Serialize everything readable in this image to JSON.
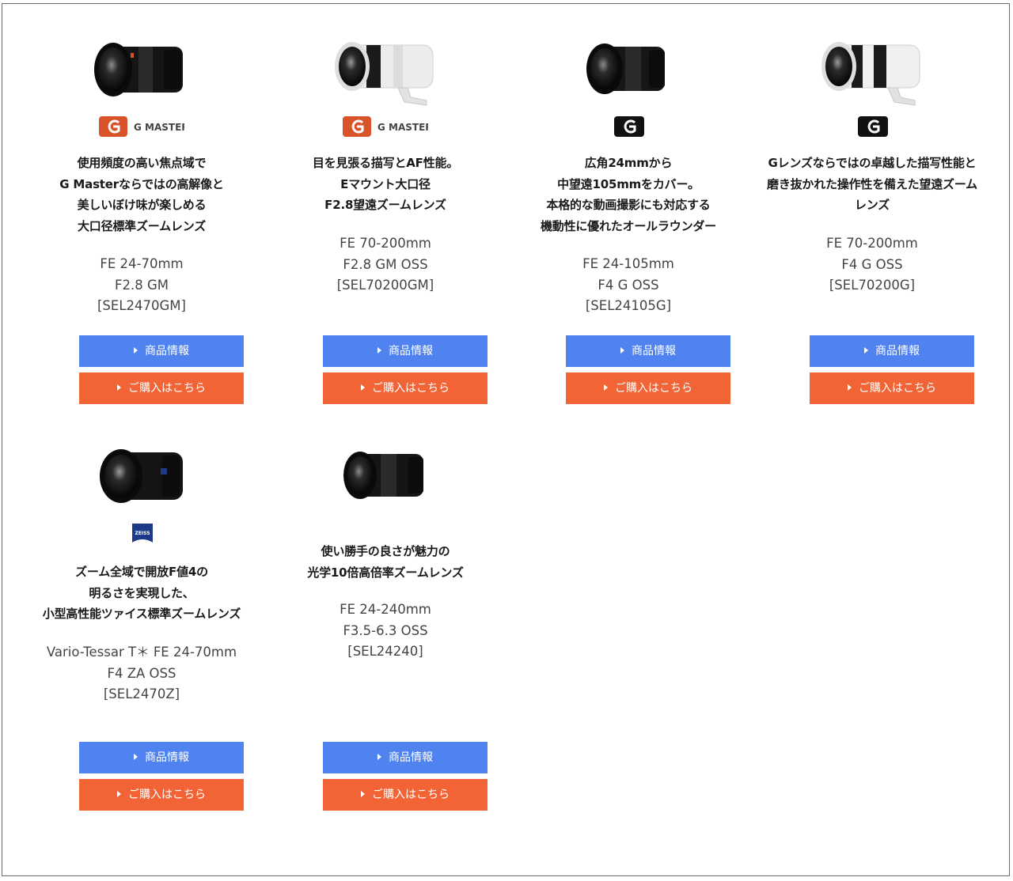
{
  "products": [
    {
      "headline": [
        "使用頻度の高い焦点域で",
        "G Masterならではの高解像と",
        "美しいぼけ味が楽しめる",
        "大口径標準ズームレンズ"
      ],
      "model": [
        "FE 24-70mm",
        "F2.8 GM",
        "[SEL2470GM]"
      ],
      "badge": "G MASTER",
      "badge_icon": "g-master-logo-icon",
      "lens_icon": "black-zoom-lens-icon",
      "info_label": "商品情報",
      "buy_label": "ご購入はこちら"
    },
    {
      "headline": [
        "目を見張る描写とAF性能。",
        "Eマウント大口径",
        "F2.8望遠ズームレンズ"
      ],
      "model": [
        "FE 70-200mm",
        "F2.8 GM OSS",
        "[SEL70200GM]"
      ],
      "badge": "G MASTER",
      "badge_icon": "g-master-logo-icon",
      "lens_icon": "white-telephoto-lens-icon",
      "info_label": "商品情報",
      "buy_label": "ご購入はこちら"
    },
    {
      "headline": [
        "広角24mmから",
        "中望遠105mmをカバー。",
        "本格的な動画撮影にも対応する",
        "機動性に優れたオールラウンダー"
      ],
      "model": [
        "FE 24-105mm",
        "F4 G OSS",
        "[SEL24105G]"
      ],
      "badge_icon": "g-lens-logo-icon",
      "lens_icon": "black-zoom-lens-icon",
      "info_label": "商品情報",
      "buy_label": "ご購入はこちら"
    },
    {
      "headline": [
        "Gレンズならではの卓越した描写性能と",
        "磨き抜かれた操作性を備えた望遠ズーム",
        "レンズ"
      ],
      "model": [
        "FE 70-200mm",
        "F4 G OSS",
        "[SEL70200G]"
      ],
      "badge_icon": "g-lens-logo-icon",
      "lens_icon": "white-telephoto-lens-icon",
      "info_label": "商品情報",
      "buy_label": "ご購入はこちら"
    },
    {
      "headline": [
        "ズーム全域で開放F値4の",
        "明るさを実現した、",
        "小型高性能ツァイス標準ズームレンズ"
      ],
      "model": [
        "Vario-Tessar T＊ FE 24-70mm",
        "F4 ZA OSS",
        "[SEL2470Z]"
      ],
      "badge": "ZEISS",
      "badge_icon": "zeiss-logo-icon",
      "lens_icon": "black-compact-lens-icon",
      "info_label": "商品情報",
      "buy_label": "ご購入はこちら"
    },
    {
      "headline": [
        "使い勝手の良さが魅力の",
        "光学10倍高倍率ズームレンズ"
      ],
      "model": [
        "FE 24-240mm",
        "F3.5-6.3 OSS",
        "[SEL24240]"
      ],
      "lens_icon": "black-zoom-lens-icon",
      "info_label": "商品情報",
      "buy_label": "ご購入はこちら"
    }
  ],
  "colors": {
    "info_button": "#5083ef",
    "buy_button": "#f26436",
    "g_master_orange": "#d8532a",
    "border": "#6b6b6b"
  }
}
